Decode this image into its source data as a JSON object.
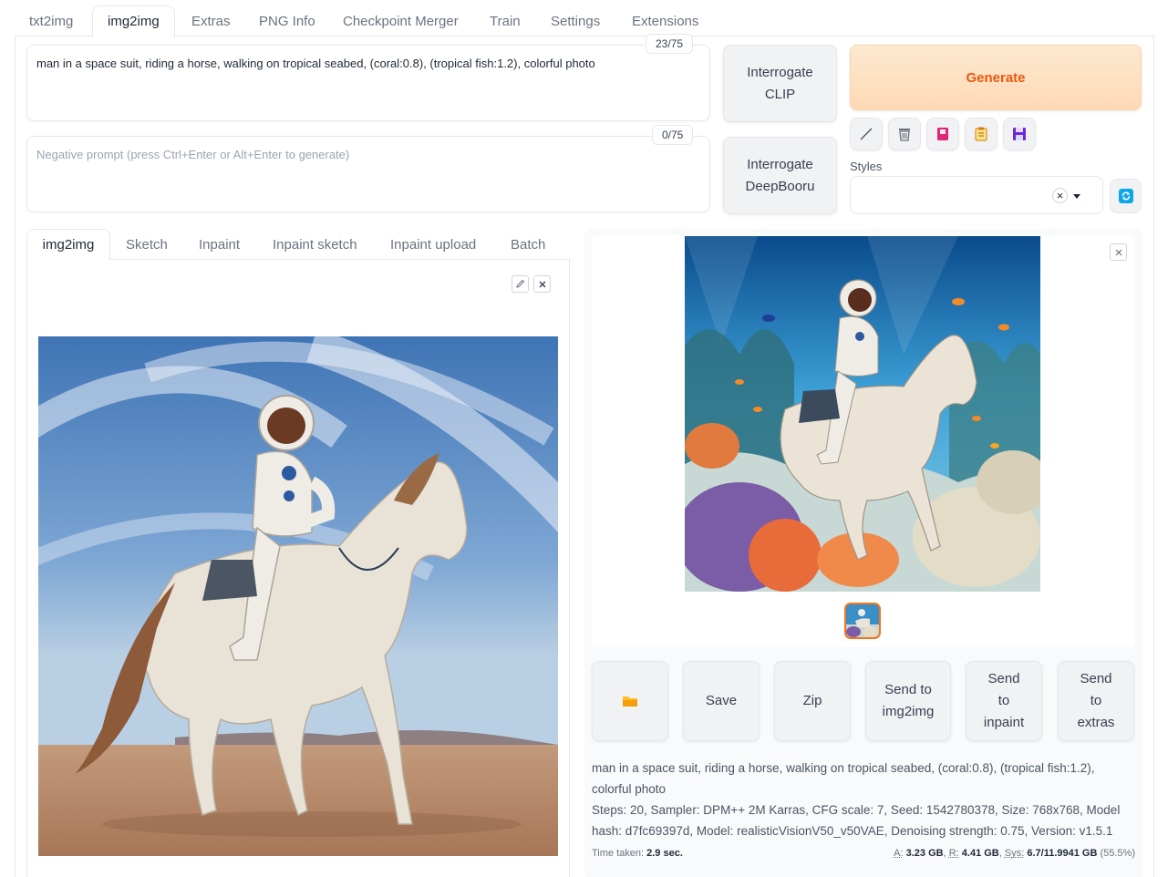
{
  "top_tabs": [
    {
      "label": "txt2img"
    },
    {
      "label": "img2img"
    },
    {
      "label": "Extras"
    },
    {
      "label": "PNG Info"
    },
    {
      "label": "Checkpoint Merger"
    },
    {
      "label": "Train"
    },
    {
      "label": "Settings"
    },
    {
      "label": "Extensions"
    }
  ],
  "prompt": {
    "value": "man in a space suit, riding a horse, walking on tropical seabed, (coral:0.8), (tropical fish:1.2), colorful photo",
    "token_count": "23/75"
  },
  "negative_prompt": {
    "placeholder": "Negative prompt (press Ctrl+Enter or Alt+Enter to generate)",
    "token_count": "0/75"
  },
  "buttons": {
    "interrogate_clip": "Interrogate CLIP",
    "interrogate_deepbooru": "Interrogate DeepBooru",
    "generate": "Generate"
  },
  "tools": [
    {
      "icon": "pencil-icon",
      "color": "#4b5563"
    },
    {
      "icon": "trash-icon",
      "color": "#6b7280"
    },
    {
      "icon": "bookmark-card-icon",
      "color": "#db2777"
    },
    {
      "icon": "clipboard-icon",
      "color": "#d97706"
    },
    {
      "icon": "floppy-disk-icon",
      "color": "#7c3aed"
    }
  ],
  "styles": {
    "label": "Styles",
    "value": ""
  },
  "sub_tabs": [
    {
      "label": "img2img"
    },
    {
      "label": "Sketch"
    },
    {
      "label": "Inpaint"
    },
    {
      "label": "Inpaint sketch"
    },
    {
      "label": "Inpaint upload"
    },
    {
      "label": "Batch"
    }
  ],
  "input_image": {
    "icon": "astronaut-horse-desert-image"
  },
  "output_image": {
    "icon": "astronaut-horse-underwater-image"
  },
  "output_buttons": [
    {
      "label": "",
      "icon": "folder-icon"
    },
    {
      "label": "Save"
    },
    {
      "label": "Zip"
    },
    {
      "label": "Send to img2img"
    },
    {
      "label": "Send to inpaint"
    },
    {
      "label": "Send to extras"
    }
  ],
  "generation_info": {
    "prompt": "man in a space suit, riding a horse, walking on tropical seabed, (coral:0.8), (tropical fish:1.2), colorful photo",
    "params": "Steps: 20, Sampler: DPM++ 2M Karras, CFG scale: 7, Seed: 1542780378, Size: 768x768, Model hash: d7fc69397d, Model: realisticVisionV50_v50VAE, Denoising strength: 0.75, Version: v1.5.1"
  },
  "footer": {
    "time_label": "Time taken:",
    "time_value": "2.9 sec.",
    "a_label": "A:",
    "a_value": "3.23 GB",
    "r_label": "R:",
    "r_value": "4.41 GB",
    "sys_label": "Sys:",
    "sys_value": "6.7/11.9941 GB",
    "sys_pct": "(55.5%)"
  },
  "colors": {
    "accent": "#ea580c",
    "generate_bg": "#fdd9b4",
    "refresh": "#0ea5e9"
  }
}
